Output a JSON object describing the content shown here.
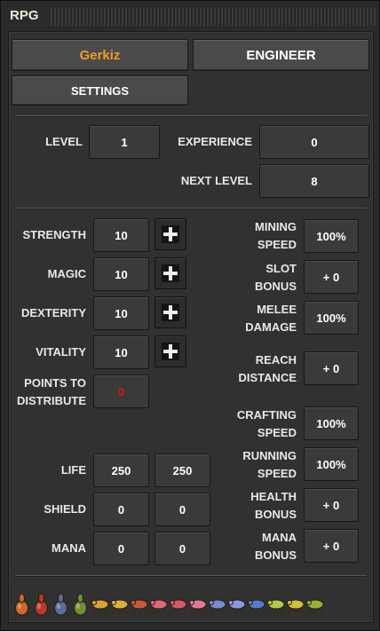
{
  "window": {
    "title": "RPG"
  },
  "header": {
    "player_name": "Gerkiz",
    "class_name": "ENGINEER",
    "settings_label": "SETTINGS"
  },
  "colors": {
    "player_name": "#f19b2b",
    "points_value": "#d21a12"
  },
  "level": {
    "level_label": "LEVEL",
    "level_value": "1",
    "experience_label": "EXPERIENCE",
    "experience_value": "0",
    "next_level_label": "NEXT LEVEL",
    "next_level_value": "8"
  },
  "attributes": [
    {
      "label": "STRENGTH",
      "value": "10"
    },
    {
      "label": "MAGIC",
      "value": "10"
    },
    {
      "label": "DEXTERITY",
      "value": "10"
    },
    {
      "label": "VITALITY",
      "value": "10"
    }
  ],
  "points": {
    "label_line1": "POINTS TO",
    "label_line2": "DISTRIBUTE",
    "value": "0"
  },
  "bonuses": [
    {
      "line1": "MINING",
      "line2": "SPEED",
      "value": "100%"
    },
    {
      "line1": "SLOT",
      "line2": "BONUS",
      "value": "+ 0"
    },
    {
      "line1": "MELEE",
      "line2": "DAMAGE",
      "value": "100%"
    },
    {
      "line1": "REACH",
      "line2": "DISTANCE",
      "value": "+ 0"
    },
    {
      "line1": "CRAFTING",
      "line2": "SPEED",
      "value": "100%"
    },
    {
      "line1": "RUNNING",
      "line2": "SPEED",
      "value": "100%"
    },
    {
      "line1": "HEALTH",
      "line2": "BONUS",
      "value": "+ 0"
    },
    {
      "line1": "MANA",
      "line2": "BONUS",
      "value": "+ 0"
    }
  ],
  "stats": [
    {
      "label": "LIFE",
      "current": "250",
      "max": "250"
    },
    {
      "label": "SHIELD",
      "current": "0",
      "max": "0"
    },
    {
      "label": "MANA",
      "current": "0",
      "max": "0"
    }
  ],
  "unlocked_icons": [
    {
      "name": "small-worm-icon",
      "color": "#c96a2e"
    },
    {
      "name": "medium-worm-icon",
      "color": "#b83a2a"
    },
    {
      "name": "big-worm-icon",
      "color": "#5a6f9a"
    },
    {
      "name": "behemoth-worm-icon",
      "color": "#6f8f3a"
    },
    {
      "name": "small-biter-icon",
      "color": "#d6a23a"
    },
    {
      "name": "small-spitter-icon",
      "color": "#d8b048"
    },
    {
      "name": "medium-biter-icon",
      "color": "#c85a3a"
    },
    {
      "name": "medium-spitter-icon",
      "color": "#d86a7a"
    },
    {
      "name": "big-biter-icon",
      "color": "#d05a6a"
    },
    {
      "name": "big-spitter-icon",
      "color": "#e07a9a"
    },
    {
      "name": "behemoth-biter-icon",
      "color": "#7a8ad0"
    },
    {
      "name": "behemoth-spitter-icon",
      "color": "#8a9ae0"
    },
    {
      "name": "leviathan-biter-icon",
      "color": "#5a7ac8"
    },
    {
      "name": "leviathan-spitter-icon",
      "color": "#b0c850"
    },
    {
      "name": "extra-creature-icon",
      "color": "#d0c040"
    },
    {
      "name": "final-creature-icon",
      "color": "#9ab03a"
    }
  ]
}
